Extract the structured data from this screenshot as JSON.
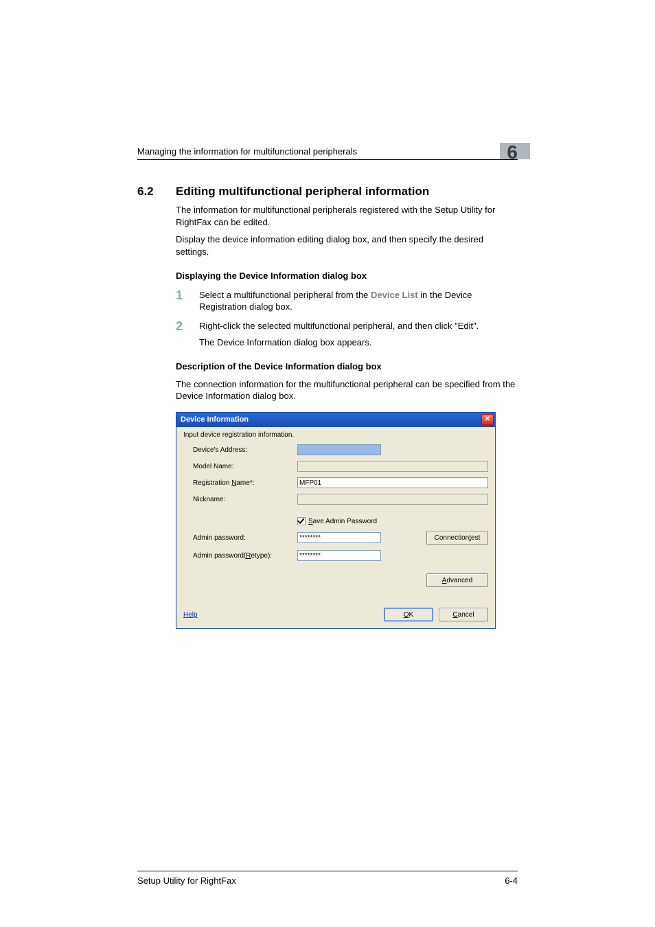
{
  "header": {
    "running_head": "Managing the information for multifunctional peripherals",
    "chapter": "6"
  },
  "section": {
    "number": "6.2",
    "title": "Editing multifunctional peripheral information",
    "p1": "The information for multifunctional peripherals registered with the Setup Utility for RightFax can be edited.",
    "p2": "Display the device information editing dialog box, and then specify the desired settings."
  },
  "sub1": {
    "title": "Displaying the Device Information dialog box",
    "steps": [
      {
        "n": "1",
        "pre": "Select a multifunctional peripheral from the ",
        "bold": "Device List",
        "post": " in the Device Registration dialog box."
      },
      {
        "n": "2",
        "text": "Right-click the selected multifunctional peripheral, and then click \"Edit\".",
        "sub": "The Device Information dialog box appears."
      }
    ]
  },
  "sub2": {
    "title": "Description of the Device Information dialog box",
    "p": "The connection information for the multifunctional peripheral can be specified from the Device Information dialog box."
  },
  "dialog": {
    "title": "Device Information",
    "instr": "Input device registration information.",
    "labels": {
      "address": "Device's Address:",
      "model": "Model Name:",
      "regname_pre": "Registration ",
      "regname_u": "N",
      "regname_post": "ame*:",
      "nickname": "Nickname:",
      "save_pre": "",
      "save_u": "S",
      "save_post": "ave Admin Password",
      "pwd": "Admin password:",
      "pwd_re_pre": "Admin password(",
      "pwd_re_u": "R",
      "pwd_re_post": "etype):"
    },
    "values": {
      "address": "",
      "model": "",
      "regname": "MFP01",
      "nickname": "",
      "pwd": "********",
      "pwd_re": "********"
    },
    "buttons": {
      "conn_pre": "Connection ",
      "conn_u": "t",
      "conn_post": "est",
      "adv_u": "A",
      "adv_post": "dvanced",
      "ok_u": "O",
      "ok_post": "K",
      "cancel_u": "C",
      "cancel_post": "ancel",
      "help": "Help"
    }
  },
  "footer": {
    "left": "Setup Utility for RightFax",
    "right": "6-4"
  }
}
